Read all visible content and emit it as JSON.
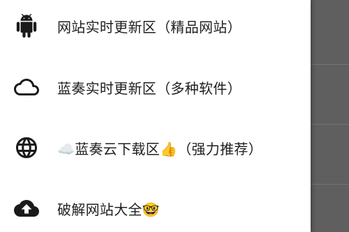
{
  "menu": {
    "items": [
      {
        "label": "网站实时更新区（精品网站）",
        "icon": "android-icon"
      },
      {
        "label": "蓝奏实时更新区（多种软件）",
        "icon": "cloud-outline-icon"
      },
      {
        "label": "☁️蓝奏云下载区👍（强力推荐）",
        "icon": "globe-icon"
      },
      {
        "label": "破解网站大全🤓",
        "icon": "cloud-upload-icon"
      }
    ]
  },
  "colors": {
    "drawer_bg": "#ffffff",
    "scrim": "#5e5e5e",
    "text": "#202020",
    "icon": "#1a1a1a"
  }
}
